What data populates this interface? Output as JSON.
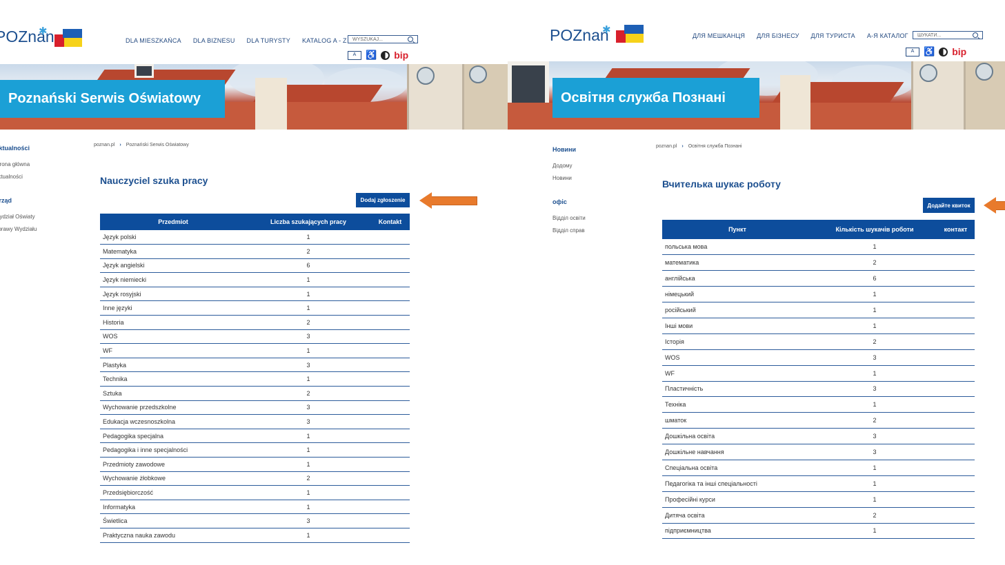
{
  "polish": {
    "logo": "POZnan",
    "nav": [
      "DLA MIESZKAŃCA",
      "DLA BIZNESU",
      "DLA TURYSTY",
      "KATALOG A - Z"
    ],
    "search_placeholder": "WYSZUKAJ...",
    "bip": "bip",
    "banner_title": "Poznański Serwis Oświatowy",
    "sidebar": {
      "group1_title": "Aktualności",
      "group1_items": [
        "Strona główna",
        "Aktualności"
      ],
      "group2_title": "Urząd",
      "group2_items": [
        "Wydział Oświaty",
        "Sprawy Wydziału"
      ]
    },
    "breadcrumb": [
      "poznan.pl",
      "Poznański Serwis Oświatowy"
    ],
    "page_title": "Nauczyciel szuka pracy",
    "add_button": "Dodaj zgłoszenie",
    "table": {
      "headers": [
        "Przedmiot",
        "Liczba szukających pracy",
        "Kontakt"
      ],
      "rows": [
        [
          "Język polski",
          "1"
        ],
        [
          "Matematyka",
          "2"
        ],
        [
          "Język angielski",
          "6"
        ],
        [
          "Język niemiecki",
          "1"
        ],
        [
          "Język rosyjski",
          "1"
        ],
        [
          "Inne języki",
          "1"
        ],
        [
          "Historia",
          "2"
        ],
        [
          "WOS",
          "3"
        ],
        [
          "WF",
          "1"
        ],
        [
          "Plastyka",
          "3"
        ],
        [
          "Technika",
          "1"
        ],
        [
          "Sztuka",
          "2"
        ],
        [
          "Wychowanie przedszkolne",
          "3"
        ],
        [
          "Edukacja wczesnoszkolna",
          "3"
        ],
        [
          "Pedagogika specjalna",
          "1"
        ],
        [
          "Pedagogika i inne specjalności",
          "1"
        ],
        [
          "Przedmioty zawodowe",
          "1"
        ],
        [
          "Wychowanie żłobkowe",
          "2"
        ],
        [
          "Przedsiębiorczość",
          "1"
        ],
        [
          "Informatyka",
          "1"
        ],
        [
          "Świetlica",
          "3"
        ],
        [
          "Praktyczna nauka zawodu",
          "1"
        ]
      ]
    }
  },
  "ukrainian": {
    "logo": "POZnan",
    "nav": [
      "ДЛЯ МЕШКАНЦЯ",
      "ДЛЯ БІЗНЕСУ",
      "ДЛЯ ТУРИСТА",
      "А-Я КАТАЛОГ"
    ],
    "search_placeholder": "ШУКАТИ...",
    "bip": "bip",
    "banner_title": "Освітня служба Познані",
    "sidebar": {
      "group1_title": "Новини",
      "group1_items": [
        "Додому",
        "Новини"
      ],
      "group2_title": "офіс",
      "group2_items": [
        "Відділ освіти",
        "Відділ справ"
      ]
    },
    "breadcrumb": [
      "poznan.pl",
      "Освітня служба Познані"
    ],
    "page_title": "Вчителька шукає роботу",
    "add_button": "Додайте квиток",
    "table": {
      "headers": [
        "Пункт",
        "Кількість шукачів роботи",
        "контакт"
      ],
      "rows": [
        [
          "польська мова",
          "1"
        ],
        [
          "математика",
          "2"
        ],
        [
          "англійська",
          "6"
        ],
        [
          "німецький",
          "1"
        ],
        [
          "російський",
          "1"
        ],
        [
          "Інші мови",
          "1"
        ],
        [
          "Історія",
          "2"
        ],
        [
          "WOS",
          "3"
        ],
        [
          "WF",
          "1"
        ],
        [
          "Пластичність",
          "3"
        ],
        [
          "Техніка",
          "1"
        ],
        [
          "шматок",
          "2"
        ],
        [
          "Дошкільна освіта",
          "3"
        ],
        [
          "Дошкільне навчання",
          "3"
        ],
        [
          "Спеціальна освіта",
          "1"
        ],
        [
          "Педагогіка та інші спеціальності",
          "1"
        ],
        [
          "Професійні курси",
          "1"
        ],
        [
          "Дитяча освіта",
          "2"
        ],
        [
          "підприємництва",
          "1"
        ]
      ]
    }
  },
  "colors": {
    "brand_blue": "#0d4d9c",
    "banner_title_bg": "#1ba0d6",
    "arrow": "#e87a2c"
  }
}
